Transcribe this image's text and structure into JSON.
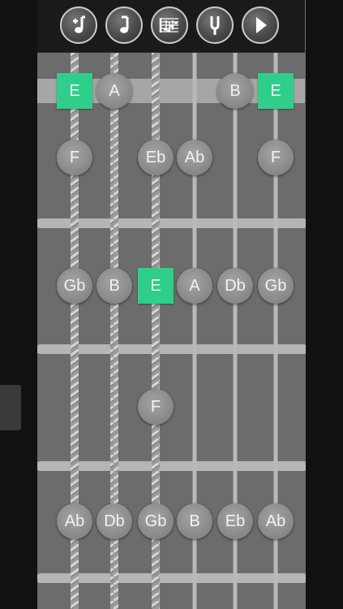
{
  "toolbar": {
    "buttons": [
      {
        "name": "add-note-button",
        "icon": "note-plus-icon"
      },
      {
        "name": "note-button",
        "icon": "eighth-note-icon"
      },
      {
        "name": "scale-staff-button",
        "icon": "staff-chords-icon"
      },
      {
        "name": "tuning-fork-button",
        "icon": "tuning-fork-icon"
      },
      {
        "name": "play-button",
        "icon": "play-icon"
      }
    ]
  },
  "colors": {
    "root_note": "#2fcf8b",
    "note": "#8b8b8b",
    "fretboard": "#6c6c6c",
    "fret_wire": "#b5b5b5"
  },
  "notes": [
    {
      "label": "E",
      "string": 1,
      "fret": 0,
      "root": true
    },
    {
      "label": "A",
      "string": 2,
      "fret": 0,
      "root": false
    },
    {
      "label": "B",
      "string": 5,
      "fret": 0,
      "root": false
    },
    {
      "label": "E",
      "string": 6,
      "fret": 0,
      "root": true
    },
    {
      "label": "F",
      "string": 1,
      "fret": 1,
      "root": false
    },
    {
      "label": "Eb",
      "string": 3,
      "fret": 1,
      "root": false
    },
    {
      "label": "Ab",
      "string": 4,
      "fret": 1,
      "root": false
    },
    {
      "label": "F",
      "string": 6,
      "fret": 1,
      "root": false
    },
    {
      "label": "Gb",
      "string": 1,
      "fret": 2,
      "root": false
    },
    {
      "label": "B",
      "string": 2,
      "fret": 2,
      "root": false
    },
    {
      "label": "E",
      "string": 3,
      "fret": 2,
      "root": true
    },
    {
      "label": "A",
      "string": 4,
      "fret": 2,
      "root": false
    },
    {
      "label": "Db",
      "string": 5,
      "fret": 2,
      "root": false
    },
    {
      "label": "Gb",
      "string": 6,
      "fret": 2,
      "root": false
    },
    {
      "label": "F",
      "string": 3,
      "fret": 3,
      "root": false
    },
    {
      "label": "Ab",
      "string": 1,
      "fret": 4,
      "root": false
    },
    {
      "label": "Db",
      "string": 2,
      "fret": 4,
      "root": false
    },
    {
      "label": "Gb",
      "string": 3,
      "fret": 4,
      "root": false
    },
    {
      "label": "B",
      "string": 4,
      "fret": 4,
      "root": false
    },
    {
      "label": "Eb",
      "string": 5,
      "fret": 4,
      "root": false
    },
    {
      "label": "Ab",
      "string": 6,
      "fret": 4,
      "root": false
    }
  ]
}
